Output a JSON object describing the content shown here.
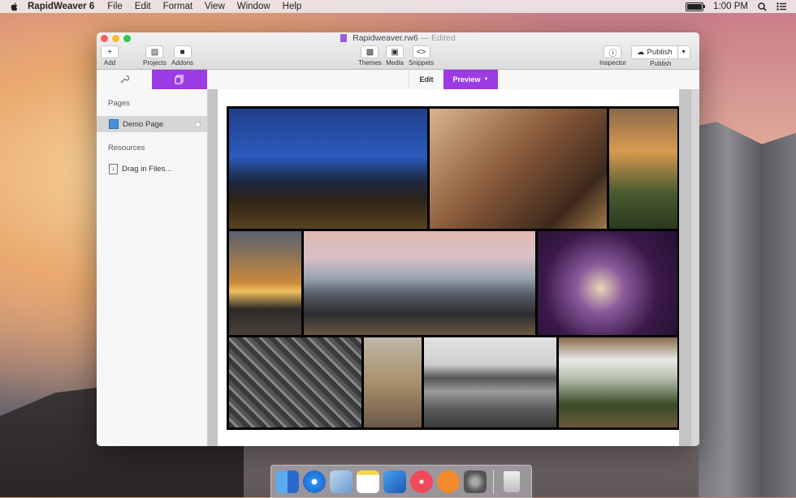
{
  "menubar": {
    "app_name": "RapidWeaver 6",
    "items": [
      "File",
      "Edit",
      "Format",
      "View",
      "Window",
      "Help"
    ],
    "clock": "1:00 PM"
  },
  "window": {
    "title": "Rapidweaver.rw6",
    "edited": "— Edited"
  },
  "toolbar": {
    "add": "Add",
    "projects": "Projects",
    "addons": "Addons",
    "themes": "Themes",
    "media": "Media",
    "snippets": "Snippets",
    "inspector": "Inspector",
    "publish_button": "Publish",
    "publish_label": "Publish"
  },
  "tabs": {
    "edit": "Edit",
    "preview": "Preview"
  },
  "sidebar": {
    "pages_header": "Pages",
    "page_name": "Demo Page",
    "resources_header": "Resources",
    "drag_files": "Drag in Files..."
  },
  "colors": {
    "accent": "#9a3be3"
  },
  "dock": [
    "finder-icon",
    "safari-icon",
    "mail-icon",
    "notes-icon",
    "xcode-icon",
    "itunes-icon",
    "ibooks-icon",
    "system-preferences-icon",
    "trash-icon"
  ]
}
